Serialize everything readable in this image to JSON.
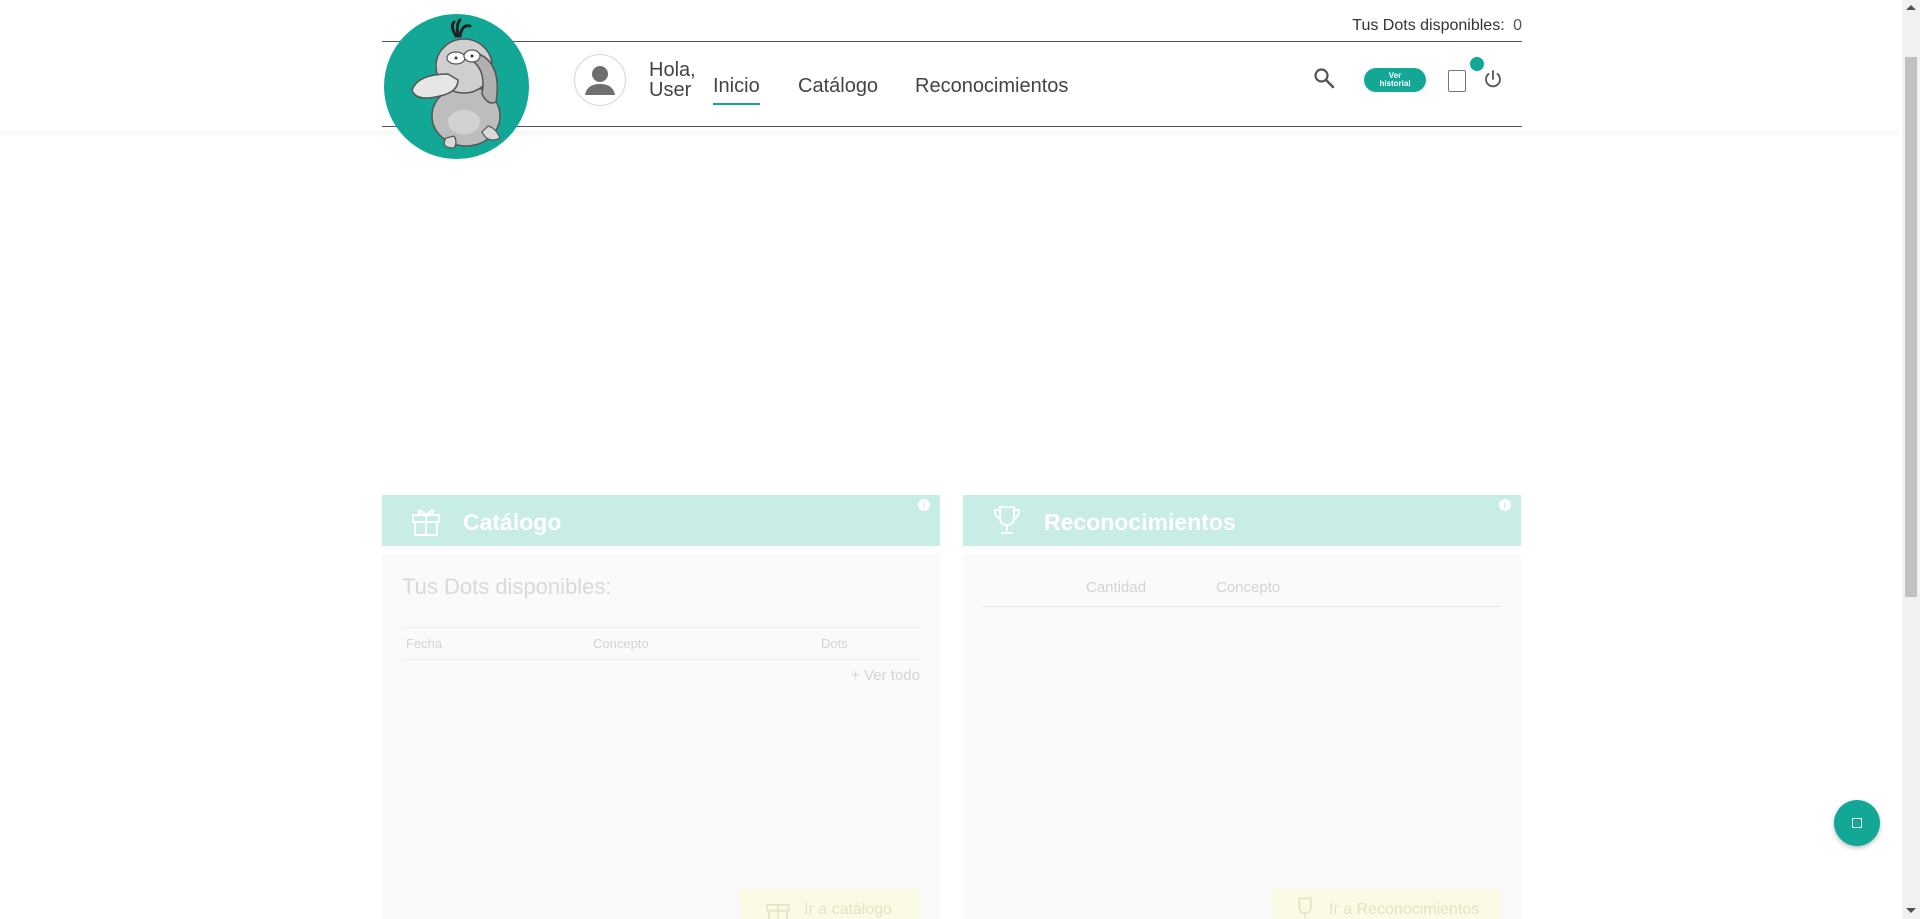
{
  "header": {
    "dots_label": "Tus Dots disponibles:",
    "dots_value": "0",
    "greeting_line1": "Hola,",
    "greeting_line2": "User",
    "nav": {
      "home": "Inicio",
      "catalog": "Catálogo",
      "recognitions": "Reconocimientos"
    },
    "history_line1": "Ver",
    "history_line2": "historial"
  },
  "catalog_panel": {
    "title": "Catálogo",
    "info": "i",
    "dots_label": "Tus Dots disponibles:",
    "columns": [
      "Fecha",
      "Concepto",
      "Dots"
    ],
    "see_all": "+ Ver todo",
    "button": "Ir a catálogo"
  },
  "recognitions_panel": {
    "title": "Reconocimientos",
    "info": "i",
    "columns": [
      "Cantidad",
      "Concepto"
    ],
    "button": "Ir a Reconocimientos"
  },
  "colors": {
    "accent": "#13a896",
    "panel_header": "#c8ece6",
    "yellow_button": "#fbfbe5"
  }
}
